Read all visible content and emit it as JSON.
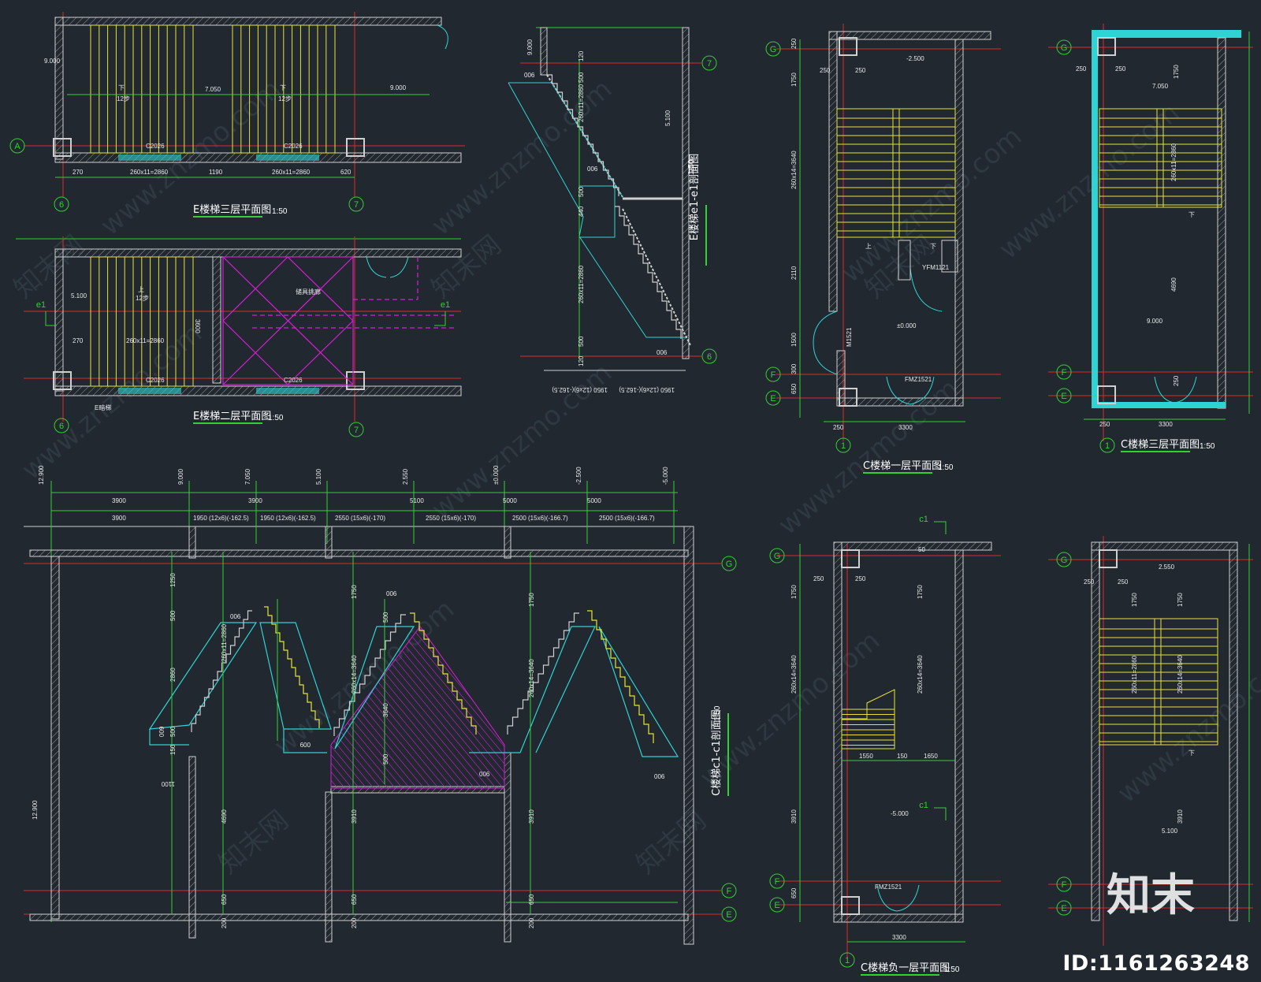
{
  "colors": {
    "background": "#212830",
    "wall": "#cfcfcf",
    "dimension": "#33d033",
    "axis": "#e02828",
    "stair": "#e6e23a",
    "cyan": "#2fd3d3",
    "magenta": "#d61fd6",
    "text": "#e8e8e8"
  },
  "titles": {
    "e3": "E楼梯三层平面图",
    "e2": "E楼梯二层平面图",
    "ee": "E楼梯e1-e1剖面图",
    "c1": "C楼梯一层平面图",
    "c3": "C楼梯三层平面图",
    "cb": "C楼梯负一层平面图",
    "cc": "C楼梯c1-c1剖面图",
    "scale": "1:50"
  },
  "axis_labels": {
    "a": "A",
    "six": "6",
    "seven": "7",
    "e1": "e1",
    "c1": "c1",
    "g": "G",
    "f": "F",
    "e": "E",
    "one": "1"
  },
  "e3": {
    "elev_left": "9.000",
    "elev_mid": "7.050",
    "elev_right": "9.000",
    "down": "下",
    "steps": "12步",
    "window": "C2026",
    "dims": [
      "270",
      "260x11=2860",
      "1190",
      "260x11=2860",
      "620"
    ]
  },
  "e2": {
    "elev": "5.100",
    "up": "上",
    "steps": "12步",
    "window": "C2026",
    "dims": [
      "270",
      "260x11=2860"
    ],
    "height": "3600",
    "note": "E暗梯",
    "room": "储具挑廊"
  },
  "ee": {
    "elev_top": "9.000",
    "elev_mid": "5.100",
    "dims_v": [
      "120",
      "500",
      "260x11=2860",
      "440",
      "500",
      "260x11=2860",
      "500",
      "120"
    ],
    "dims_h": [
      "006",
      "006",
      "006"
    ],
    "bottom_dims": [
      "1950 (12x6)(-162.5)",
      "1950 (12x6)(-162.5)"
    ]
  },
  "c1": {
    "dims_v": [
      "250",
      "1750",
      "260x14=3640",
      "2110",
      "1500",
      "300",
      "650"
    ],
    "elev_top": "-2.500",
    "elev_main": "±0.000",
    "door1": "YFM1121",
    "door2": "FMZ1521",
    "window": "M1521",
    "width": "3300",
    "left": "250",
    "top_left": "250",
    "top": "250",
    "up": "上",
    "down": "下"
  },
  "c3": {
    "elev_top": "7.050",
    "elev_main": "9.000",
    "dims_v": [
      "1750",
      "260x11=2860",
      "4690",
      "250"
    ],
    "width": "3300",
    "left": "250",
    "top_left": "250",
    "top": "250",
    "down": "下"
  },
  "cb": {
    "dims_v": [
      "1750",
      "260x14=3640",
      "3910",
      "650"
    ],
    "inner_dims": [
      "1750",
      "260x14=3640"
    ],
    "bottom_dims": [
      "1550",
      "150",
      "1650"
    ],
    "elev": "-5.000",
    "door": "FMZ1521",
    "width": "3300",
    "left": "250",
    "top": "250",
    "top2": "50"
  },
  "cx": {
    "elev_top": "2.550",
    "elev_main": "5.100",
    "dims_v": [
      "1750",
      "260x11=2860",
      "1750",
      "260x14=3640",
      "3910"
    ],
    "left": "250",
    "top": "250",
    "down": "下"
  },
  "cc": {
    "elevs": [
      "12.900",
      "9.000",
      "7.050",
      "5.100",
      "2.550",
      "±0.000",
      "-2.500",
      "-5.000"
    ],
    "spans": [
      "3900",
      "3900",
      "5100",
      "5000",
      "5000"
    ],
    "sub_spans": [
      "3900",
      "1950 (12x6)(-162.5)",
      "1950 (12x6)(-162.5)",
      "2550 (15x6)(-170)",
      "2550 (15x6)(-170)",
      "2500 (15x6)(-166.7)",
      "2500 (15x6)(-166.7)"
    ],
    "dims_a": [
      "1250",
      "500",
      "260x11=2860",
      "2860",
      "500",
      "150",
      "009",
      "1100"
    ],
    "dims_b": [
      "1750",
      "500",
      "260x14=3640",
      "3640",
      "500",
      "4690",
      "650",
      "200"
    ],
    "dims_c": [
      "1750",
      "500",
      "260x14=3640",
      "3910",
      "650",
      "200"
    ],
    "dims_d": [
      "1750",
      "650",
      "200",
      "3910"
    ],
    "side": "12.900",
    "small": [
      "006",
      "006",
      "009",
      "006",
      "1100"
    ]
  },
  "watermark": {
    "id": "ID:1161263248",
    "logo": "知末",
    "site": "www.znzmo.com",
    "brand": "知末网"
  }
}
